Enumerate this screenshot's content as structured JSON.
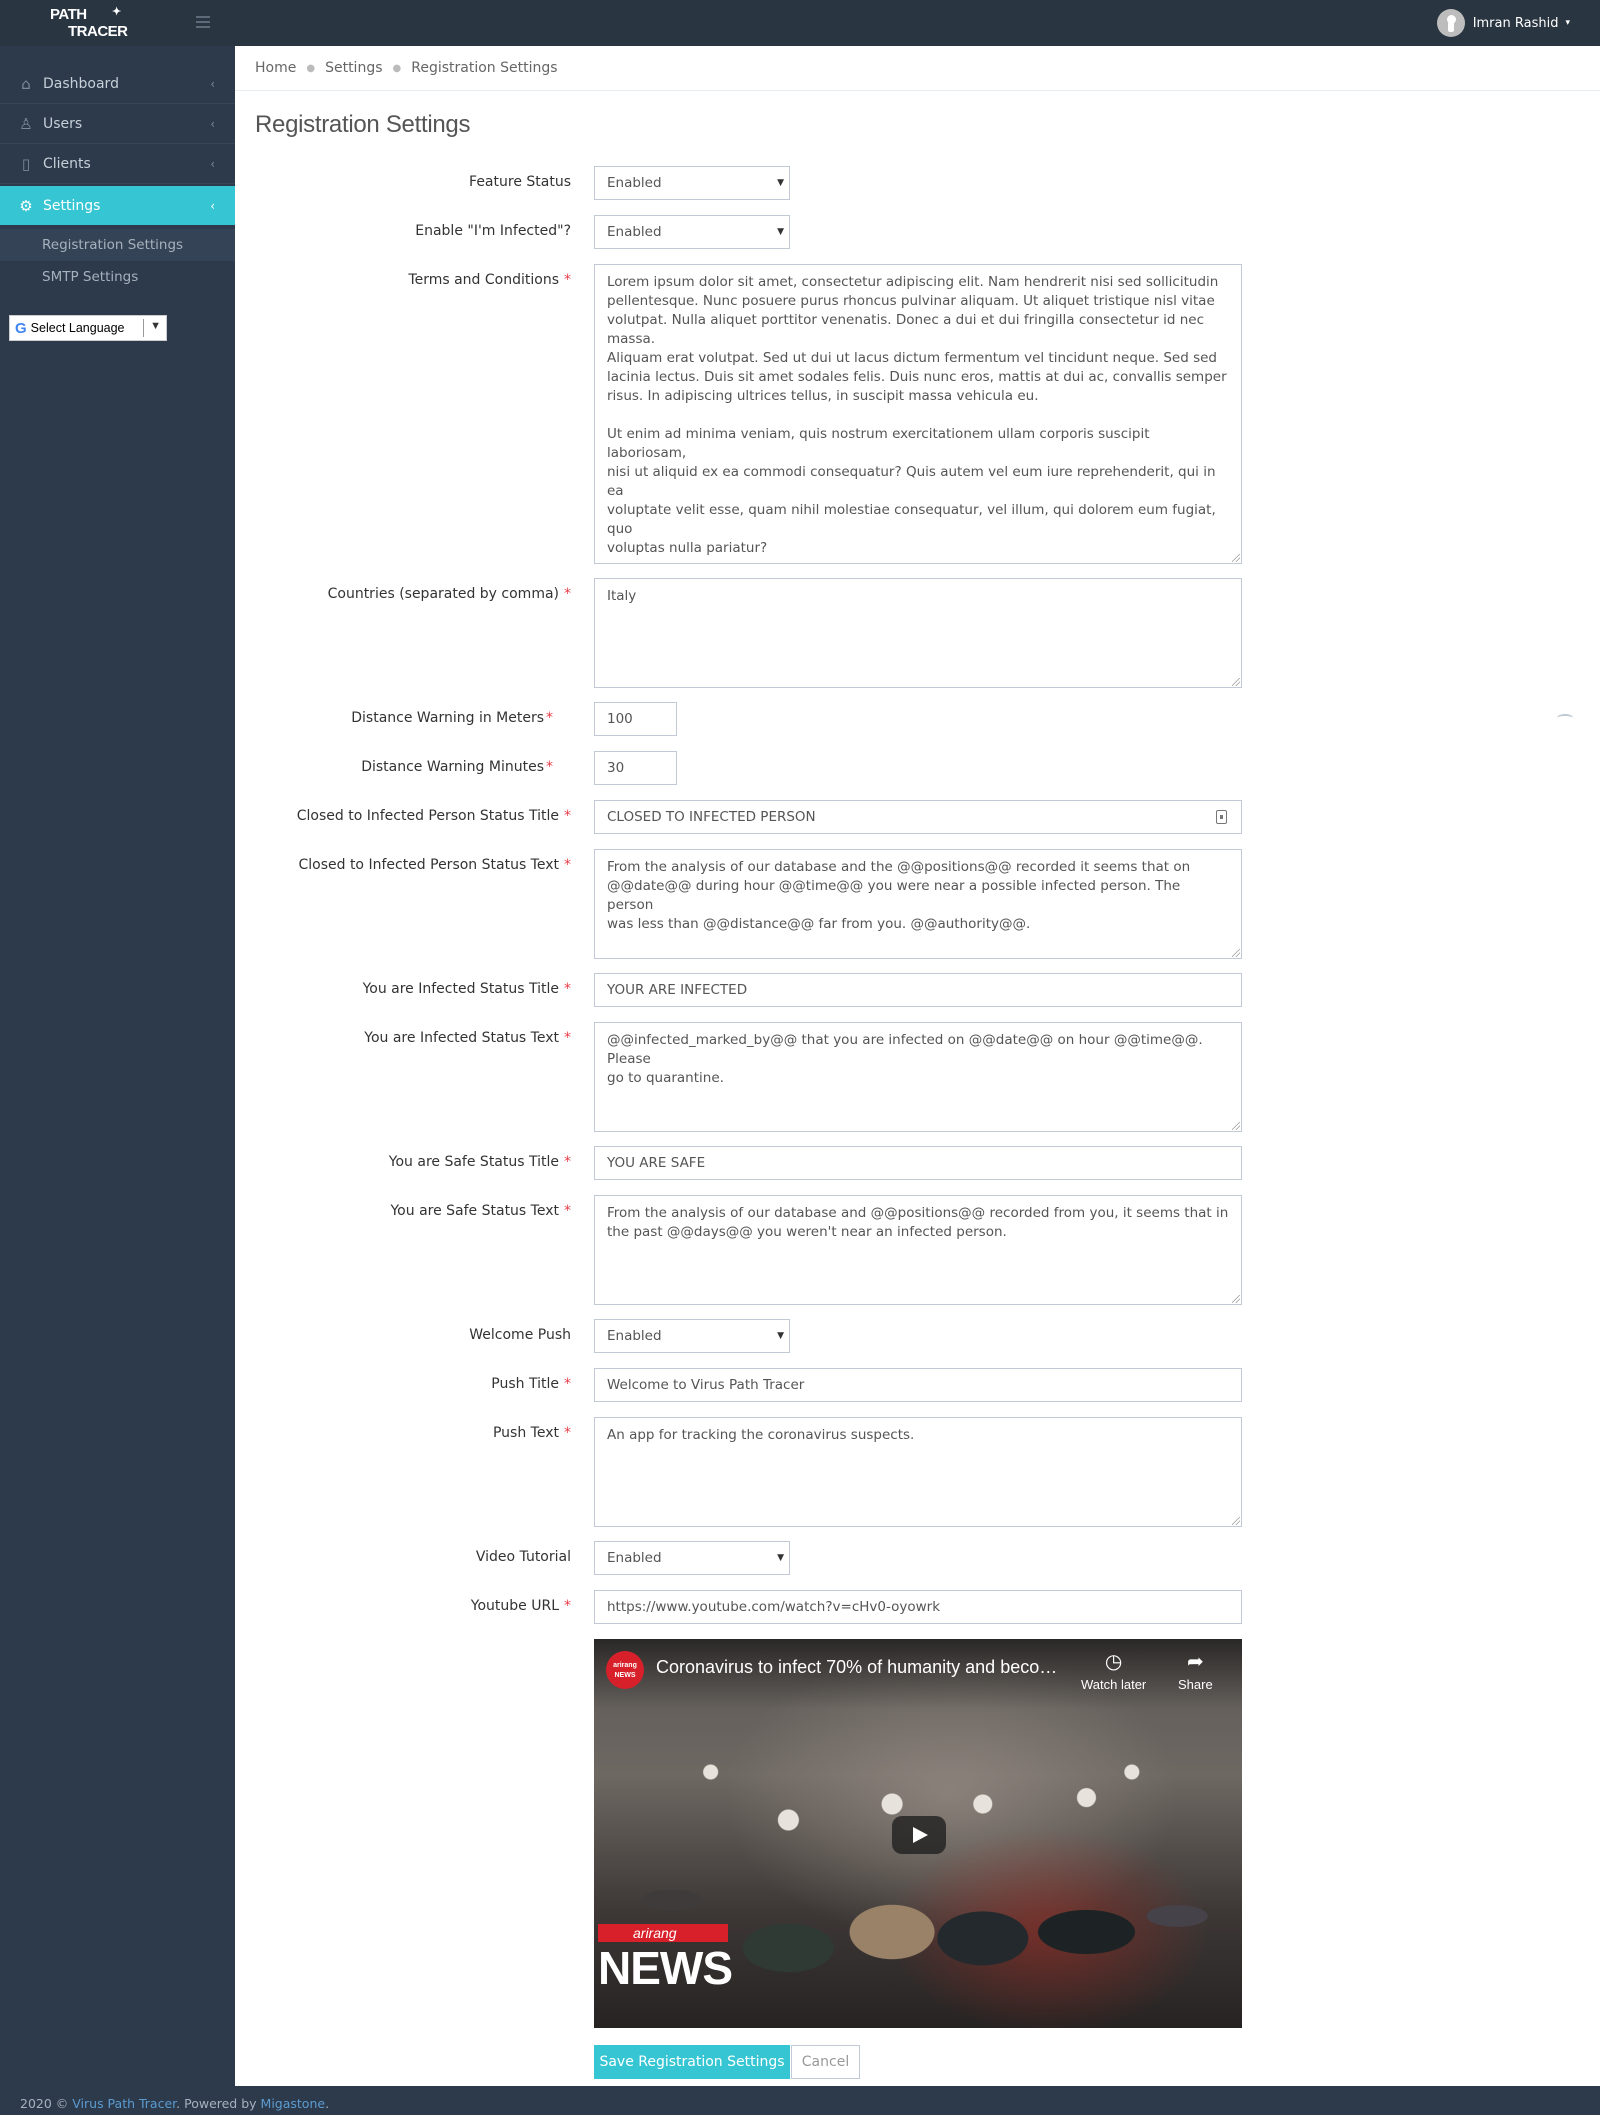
{
  "app": {
    "logo_line1": "PATH",
    "logo_line2": "TRACER",
    "user_name": "Imran Rashid"
  },
  "colors": {
    "accent": "#36c6d3",
    "sidebar_bg": "#2c3a4b",
    "required": "#e73d4a",
    "link": "#5b9bd1"
  },
  "sidebar": {
    "items": [
      {
        "label": "Dashboard",
        "icon": "home-icon"
      },
      {
        "label": "Users",
        "icon": "user-icon"
      },
      {
        "label": "Clients",
        "icon": "phone-icon"
      },
      {
        "label": "Settings",
        "icon": "gear-icon"
      }
    ],
    "sub_items": [
      {
        "label": "Registration Settings"
      },
      {
        "label": "SMTP Settings"
      }
    ],
    "language_selector": "Select Language"
  },
  "breadcrumb": [
    "Home",
    "Settings",
    "Registration Settings"
  ],
  "page_title": "Registration Settings",
  "form": {
    "feature_status": {
      "label": "Feature Status",
      "value": "Enabled"
    },
    "enable_infected": {
      "label": "Enable \"I'm Infected\"?",
      "value": "Enabled"
    },
    "terms": {
      "label": "Terms and Conditions",
      "value": "Lorem ipsum dolor sit amet, consectetur adipiscing elit. Nam hendrerit nisi sed sollicitudin\npellentesque. Nunc posuere purus rhoncus pulvinar aliquam. Ut aliquet tristique nisl vitae\nvolutpat. Nulla aliquet porttitor venenatis. Donec a dui et dui fringilla consectetur id nec massa.\nAliquam erat volutpat. Sed ut dui ut lacus dictum fermentum vel tincidunt neque. Sed sed\nlacinia lectus. Duis sit amet sodales felis. Duis nunc eros, mattis at dui ac, convallis semper\nrisus. In adipiscing ultrices tellus, in suscipit massa vehicula eu.\n\nUt enim ad minima veniam, quis nostrum exercitationem ullam corporis suscipit laboriosam,\nnisi ut aliquid ex ea commodi consequatur? Quis autem vel eum iure reprehenderit, qui in ea\nvoluptate velit esse, quam nihil molestiae consequatur, vel illum, qui dolorem eum fugiat, quo\nvoluptas nulla pariatur?"
    },
    "countries": {
      "label": "Countries (separated by comma)",
      "value": "Italy"
    },
    "distance_meters": {
      "label": "Distance Warning in Meters",
      "value": "100"
    },
    "distance_minutes": {
      "label": "Distance Warning Minutes",
      "value": "30"
    },
    "closed_title": {
      "label": "Closed to Infected Person Status Title",
      "value": "CLOSED TO INFECTED PERSON"
    },
    "closed_text": {
      "label": "Closed to Infected Person Status Text",
      "value": "From the analysis of our database and the @@positions@@ recorded it seems that on\n@@date@@ during hour @@time@@ you were near a possible infected person. The person\nwas less than @@distance@@ far from you. @@authority@@."
    },
    "infected_title": {
      "label": "You are Infected Status Title",
      "value": "YOUR ARE INFECTED"
    },
    "infected_text": {
      "label": "You are Infected Status Text",
      "value": "@@infected_marked_by@@ that you are infected on @@date@@ on hour @@time@@. Please\ngo to quarantine."
    },
    "safe_title": {
      "label": "You are Safe Status Title",
      "value": "YOU ARE SAFE"
    },
    "safe_text": {
      "label": "You are Safe Status Text",
      "value": "From the analysis of our database and @@positions@@ recorded from you, it seems that in\nthe past @@days@@ you weren't near an infected person."
    },
    "welcome_push": {
      "label": "Welcome Push",
      "value": "Enabled"
    },
    "push_title": {
      "label": "Push Title",
      "value": "Welcome to Virus Path Tracer"
    },
    "push_text": {
      "label": "Push Text",
      "value": "An app for tracking the coronavirus suspects."
    },
    "video_tutorial": {
      "label": "Video Tutorial",
      "value": "Enabled"
    },
    "youtube_url": {
      "label": "Youtube URL",
      "value": "https://www.youtube.com/watch?v=cHv0-oyowrk"
    }
  },
  "video": {
    "title": "Coronavirus to infect 70% of humanity and becom...",
    "channel_badge_1": "arirang",
    "channel_badge_2": "NEWS",
    "watch_later": "Watch later",
    "share": "Share",
    "logo_top": "arirang",
    "logo_bottom": "NEWS"
  },
  "buttons": {
    "save": "Save Registration Settings",
    "cancel": "Cancel"
  },
  "footer": {
    "prefix": "2020 © ",
    "product_link": "Virus Path Tracer",
    "middle": ". Powered by ",
    "company_link": "Migastone",
    "suffix": "."
  }
}
